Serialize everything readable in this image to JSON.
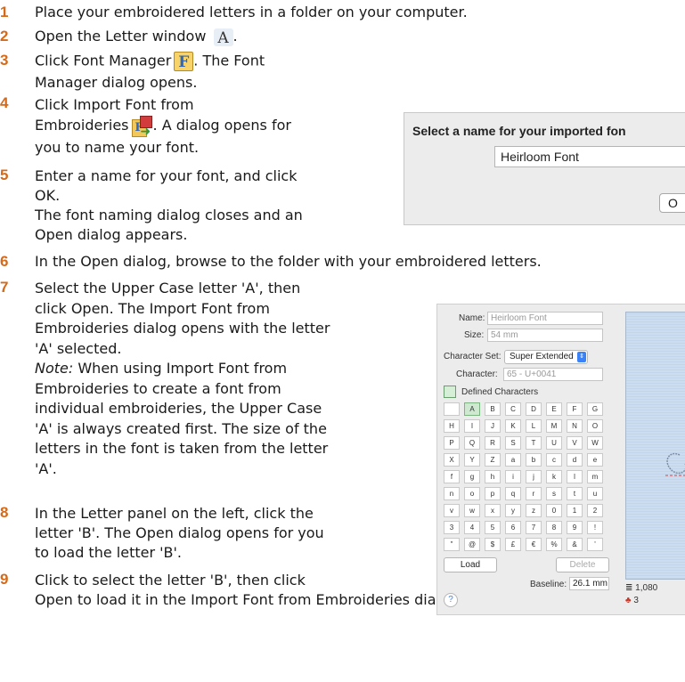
{
  "steps": [
    {
      "num": "1",
      "lines": [
        "Place your embroidered letters in a folder on your computer."
      ]
    },
    {
      "num": "2",
      "lines": [
        "Open the Letter window"
      ]
    },
    {
      "num": "3",
      "lines": [
        "Click Font Manager",
        ". The Font",
        "Manager dialog opens."
      ]
    },
    {
      "num": "4",
      "lines": [
        "Click Import Font from",
        "Embroideries",
        ". A dialog opens for",
        "you to name your font."
      ]
    },
    {
      "num": "5",
      "lines": [
        "Enter a name for your font, and click",
        "OK.",
        "The font naming dialog closes and an",
        "Open dialog appears."
      ]
    },
    {
      "num": "6",
      "lines": [
        "In the Open dialog, browse to the folder with your embroidered letters."
      ]
    },
    {
      "num": "7",
      "lines": [
        "Select the Upper Case letter 'A', then",
        "click Open. The Import Font from",
        "Embroideries dialog opens with the letter",
        "'A' selected.",
        "When using Import Font from",
        "Embroideries to create a font from",
        "individual embroideries, the Upper Case",
        "'A' is always created first. The size of the",
        "letters in the font is taken from the letter",
        "'A'."
      ],
      "note_label": "Note:"
    },
    {
      "num": "8",
      "lines": [
        "In the Letter panel on the left, click the",
        "letter 'B'. The Open dialog opens for you",
        "to load the letter 'B'."
      ]
    },
    {
      "num": "9",
      "lines": [
        "Click to select the letter 'B', then click",
        "Open to load it in the Import Font from Embroideries dialog."
      ]
    }
  ],
  "icons": {
    "letter_window": "A",
    "font_manager": "F"
  },
  "name_dialog": {
    "title": "Select a name for your imported fon",
    "value": "Heirloom Font",
    "button_label": "O"
  },
  "import_dialog": {
    "name_label": "Name:",
    "name_value": "Heirloom Font",
    "size_label": "Size:",
    "size_value": "54 mm",
    "charset_label": "Character Set:",
    "charset_value": "Super Extended",
    "character_label": "Character:",
    "character_value": "65 - U+0041",
    "defined_label": "Defined Characters",
    "chars": [
      "",
      "A",
      "B",
      "C",
      "D",
      "E",
      "F",
      "G",
      "H",
      "I",
      "J",
      "K",
      "L",
      "M",
      "N",
      "O",
      "P",
      "Q",
      "R",
      "S",
      "T",
      "U",
      "V",
      "W",
      "X",
      "Y",
      "Z",
      "a",
      "b",
      "c",
      "d",
      "e",
      "f",
      "g",
      "h",
      "i",
      "j",
      "k",
      "l",
      "m",
      "n",
      "o",
      "p",
      "q",
      "r",
      "s",
      "t",
      "u",
      "v",
      "w",
      "x",
      "y",
      "z",
      "0",
      "1",
      "2",
      "3",
      "4",
      "5",
      "6",
      "7",
      "8",
      "9",
      "!",
      "\"",
      "@",
      "$",
      "£",
      "€",
      "%",
      "&",
      "'"
    ],
    "selected_char": "A",
    "load_label": "Load",
    "delete_label": "Delete",
    "baseline_label": "Baseline:",
    "baseline_value": "26.1 mm",
    "stitch_count": "1,080",
    "color_count": "3",
    "help_label": "?"
  },
  "colors": {
    "step_number": "#d46a1a"
  }
}
